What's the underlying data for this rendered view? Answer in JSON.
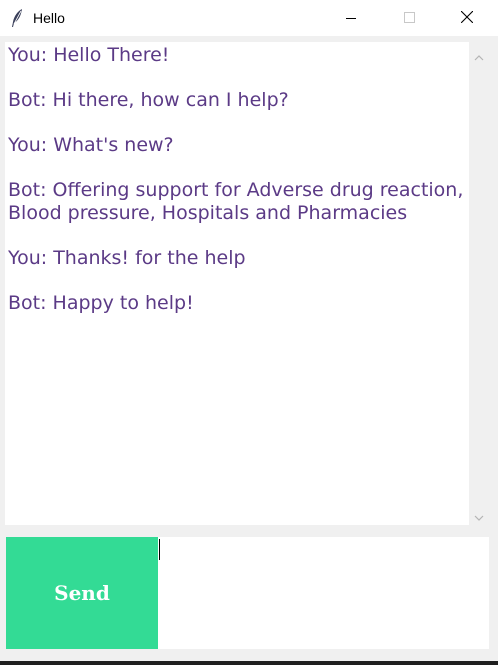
{
  "window": {
    "title": "Hello",
    "icon": "feather-icon",
    "controls": {
      "minimize": "minimize-icon",
      "maximize": "maximize-icon",
      "close": "close-icon"
    }
  },
  "chat": {
    "text_color": "#5b3a86",
    "messages": [
      "You: Hello There!",
      "Bot: Hi there, how can I help?",
      "You: What's new?",
      "Bot: Offering support for Adverse drug reaction, Blood pressure, Hospitals and Pharmacies",
      "You: Thanks! for the help",
      "Bot: Happy to help!"
    ]
  },
  "input": {
    "value": "",
    "send_label": "Send",
    "send_color": "#33db95"
  }
}
